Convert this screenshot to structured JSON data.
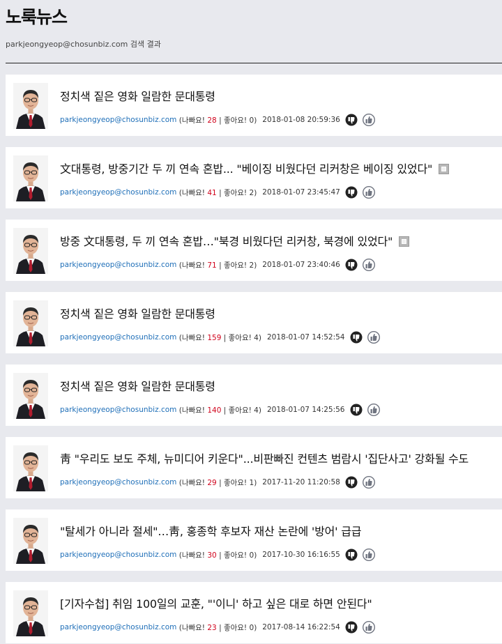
{
  "header": {
    "title": "노룩뉴스",
    "subtitle_author": "parkjeongyeop@chosunbiz.com",
    "subtitle_suffix": " 검색 결과"
  },
  "labels": {
    "bad_open": "(나빠요!",
    "good_sep": "| 좋아요!",
    "close": ")"
  },
  "articles": [
    {
      "title": "정치색 짙은 영화 일람한 문대통령",
      "author": "parkjeongyeop@chosunbiz.com",
      "bad": "28",
      "good": "0",
      "date": "2018-01-08 20:59:36",
      "expand": false
    },
    {
      "title": "文대통령, 방중기간 두 끼 연속 혼밥... \"베이징 비웠다던 리커창은 베이징 있었다\"",
      "author": "parkjeongyeop@chosunbiz.com",
      "bad": "41",
      "good": "2",
      "date": "2018-01-07 23:45:47",
      "expand": true
    },
    {
      "title": "방중 文대통령, 두 끼 연속 혼밥…\"북경 비웠다던 리커창, 북경에 있었다\"",
      "author": "parkjeongyeop@chosunbiz.com",
      "bad": "71",
      "good": "2",
      "date": "2018-01-07 23:40:46",
      "expand": true
    },
    {
      "title": "정치색 짙은 영화 일람한 문대통령",
      "author": "parkjeongyeop@chosunbiz.com",
      "bad": "159",
      "good": "4",
      "date": "2018-01-07 14:52:54",
      "expand": false
    },
    {
      "title": "정치색 짙은 영화 일람한 문대통령",
      "author": "parkjeongyeop@chosunbiz.com",
      "bad": "140",
      "good": "4",
      "date": "2018-01-07 14:25:56",
      "expand": false
    },
    {
      "title": "靑 \"우리도 보도 주체, 뉴미디어 키운다\"...비판빠진 컨텐츠 범람시 '집단사고' 강화될 수도",
      "author": "parkjeongyeop@chosunbiz.com",
      "bad": "29",
      "good": "1",
      "date": "2017-11-20 11:20:58",
      "expand": false
    },
    {
      "title": "\"탈세가 아니라 절세\"…靑, 홍종학 후보자 재산 논란에 '방어' 급급",
      "author": "parkjeongyeop@chosunbiz.com",
      "bad": "30",
      "good": "0",
      "date": "2017-10-30 16:16:55",
      "expand": false
    },
    {
      "title": "[기자수첩] 취임 100일의 교훈, \"'이니' 하고 싶은 대로 하면 안된다\"",
      "author": "parkjeongyeop@chosunbiz.com",
      "bad": "23",
      "good": "0",
      "date": "2017-08-14 16:22:54",
      "expand": false
    }
  ],
  "icons": {
    "dislike": "thumbs-down-icon",
    "like": "thumbs-up-icon",
    "expand": "expand-icon"
  }
}
